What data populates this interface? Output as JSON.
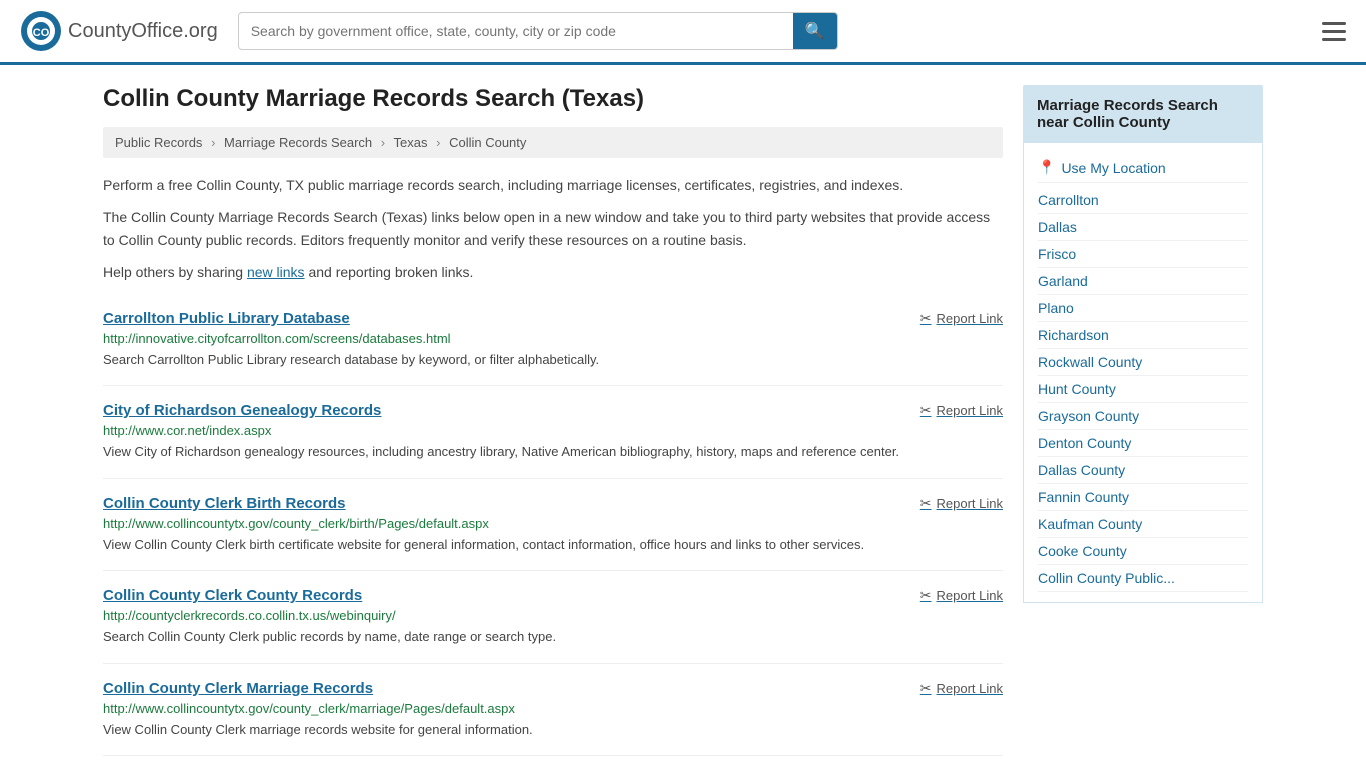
{
  "header": {
    "logo_text": "CountyOffice",
    "logo_suffix": ".org",
    "search_placeholder": "Search by government office, state, county, city or zip code"
  },
  "page": {
    "title": "Collin County Marriage Records Search (Texas)",
    "breadcrumb": {
      "items": [
        "Public Records",
        "Marriage Records Search",
        "Texas",
        "Collin County"
      ]
    },
    "intro1": "Perform a free Collin County, TX public marriage records search, including marriage licenses, certificates, registries, and indexes.",
    "intro2": "The Collin County Marriage Records Search (Texas) links below open in a new window and take you to third party websites that provide access to Collin County public records. Editors frequently monitor and verify these resources on a routine basis.",
    "intro3_before": "Help others by sharing ",
    "intro3_link": "new links",
    "intro3_after": " and reporting broken links."
  },
  "records": [
    {
      "title": "Carrollton Public Library Database",
      "url": "http://innovative.cityofcarrollton.com/screens/databases.html",
      "description": "Search Carrollton Public Library research database by keyword, or filter alphabetically."
    },
    {
      "title": "City of Richardson Genealogy Records",
      "url": "http://www.cor.net/index.aspx",
      "description": "View City of Richardson genealogy resources, including ancestry library, Native American bibliography, history, maps and reference center."
    },
    {
      "title": "Collin County Clerk Birth Records",
      "url": "http://www.collincountytx.gov/county_clerk/birth/Pages/default.aspx",
      "description": "View Collin County Clerk birth certificate website for general information, contact information, office hours and links to other services."
    },
    {
      "title": "Collin County Clerk County Records",
      "url": "http://countyclerkrecords.co.collin.tx.us/webinquiry/",
      "description": "Search Collin County Clerk public records by name, date range or search type."
    },
    {
      "title": "Collin County Clerk Marriage Records",
      "url": "http://www.collincountytx.gov/county_clerk/marriage/Pages/default.aspx",
      "description": "View Collin County Clerk marriage records website for general information."
    }
  ],
  "report_label": "Report Link",
  "sidebar": {
    "header": "Marriage Records Search near Collin County",
    "use_my_location": "Use My Location",
    "links": [
      "Carrollton",
      "Dallas",
      "Frisco",
      "Garland",
      "Plano",
      "Richardson",
      "Rockwall County",
      "Hunt County",
      "Grayson County",
      "Denton County",
      "Dallas County",
      "Fannin County",
      "Kaufman County",
      "Cooke County",
      "Collin County Public..."
    ]
  }
}
